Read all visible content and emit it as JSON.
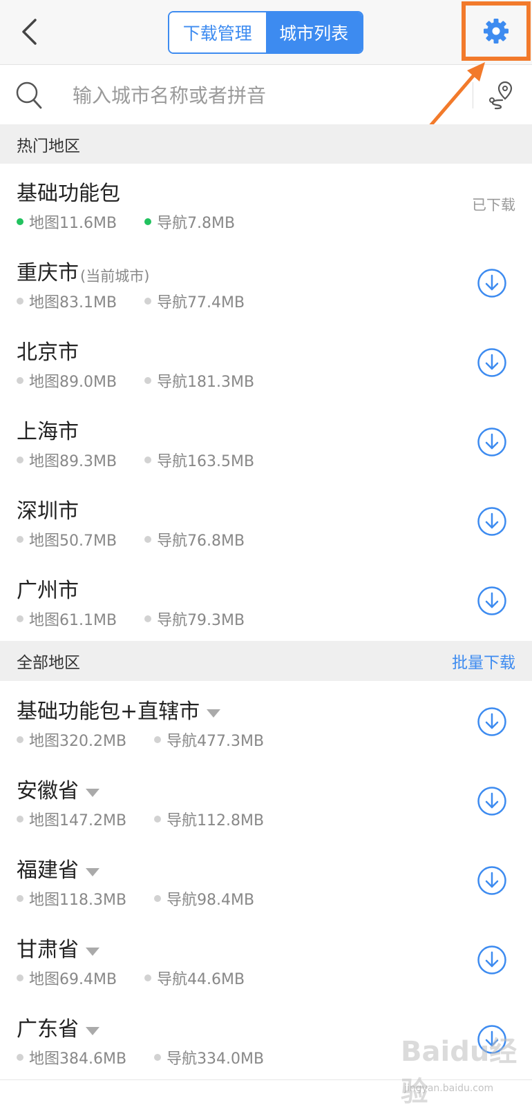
{
  "header": {
    "tabs": [
      {
        "label": "下载管理",
        "active": false
      },
      {
        "label": "城市列表",
        "active": true
      }
    ]
  },
  "search": {
    "placeholder": "输入城市名称或者拼音"
  },
  "sections": {
    "hot": {
      "title": "热门地区"
    },
    "all": {
      "title": "全部地区",
      "action": "批量下载"
    }
  },
  "hot_rows": [
    {
      "name": "基础功能包",
      "sub": "",
      "map": "地图11.6MB",
      "nav": "导航7.8MB",
      "status": "已下载",
      "downloaded": true
    },
    {
      "name": "重庆市",
      "sub": "(当前城市)",
      "map": "地图83.1MB",
      "nav": "导航77.4MB"
    },
    {
      "name": "北京市",
      "sub": "",
      "map": "地图89.0MB",
      "nav": "导航181.3MB"
    },
    {
      "name": "上海市",
      "sub": "",
      "map": "地图89.3MB",
      "nav": "导航163.5MB"
    },
    {
      "name": "深圳市",
      "sub": "",
      "map": "地图50.7MB",
      "nav": "导航76.8MB"
    },
    {
      "name": "广州市",
      "sub": "",
      "map": "地图61.1MB",
      "nav": "导航79.3MB"
    }
  ],
  "all_rows": [
    {
      "name": "基础功能包+直辖市",
      "map": "地图320.2MB",
      "nav": "导航477.3MB",
      "expandable": true
    },
    {
      "name": "安徽省",
      "map": "地图147.2MB",
      "nav": "导航112.8MB",
      "expandable": true
    },
    {
      "name": "福建省",
      "map": "地图118.3MB",
      "nav": "导航98.4MB",
      "expandable": true
    },
    {
      "name": "甘肃省",
      "map": "地图69.4MB",
      "nav": "导航44.6MB",
      "expandable": true
    },
    {
      "name": "广东省",
      "map": "地图384.6MB",
      "nav": "导航334.0MB",
      "expandable": true
    }
  ],
  "watermark": {
    "logo": "Baidu经验",
    "url": "jingyan.baidu.com"
  },
  "colors": {
    "accent": "#3d8bf0",
    "highlight": "#f27a2b",
    "downloaded_dot": "#22c25f",
    "idle_dot": "#d2d2d2"
  }
}
